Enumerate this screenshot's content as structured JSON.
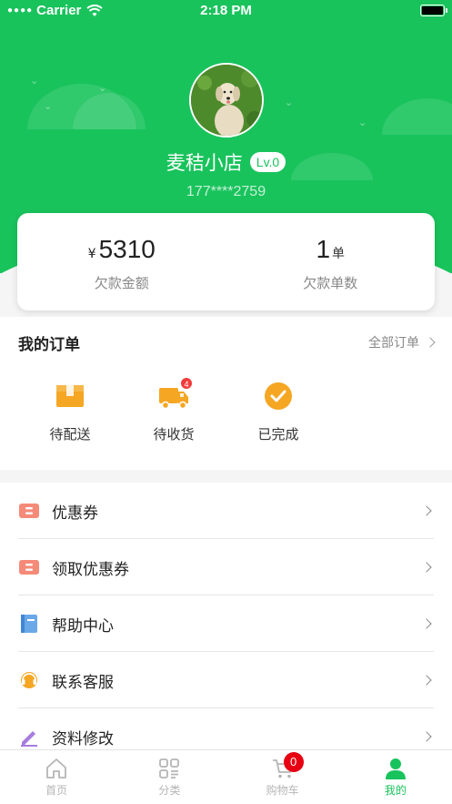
{
  "status_bar": {
    "carrier": "Carrier",
    "time": "2:18 PM"
  },
  "profile": {
    "shop_name": "麦秸小店",
    "level": "Lv.0",
    "phone": "177****2759"
  },
  "stats": {
    "debt_amount": {
      "currency": "¥",
      "value": "5310",
      "label": "欠款金额"
    },
    "debt_orders": {
      "value": "1",
      "unit": "单",
      "label": "欠款单数"
    }
  },
  "orders": {
    "title": "我的订单",
    "all_label": "全部订单",
    "items": [
      {
        "label": "待配送",
        "icon": "box-icon"
      },
      {
        "label": "待收货",
        "icon": "truck-icon",
        "badge": "4"
      },
      {
        "label": "已完成",
        "icon": "check-circle-icon"
      }
    ]
  },
  "menu": {
    "items": [
      {
        "label": "优惠券",
        "icon": "coupon-icon"
      },
      {
        "label": "领取优惠券",
        "icon": "coupon-receive-icon"
      },
      {
        "label": "帮助中心",
        "icon": "book-icon"
      },
      {
        "label": "联系客服",
        "icon": "headset-icon"
      },
      {
        "label": "资料修改",
        "icon": "edit-icon"
      }
    ]
  },
  "tabbar": {
    "items": [
      {
        "label": "首页",
        "icon": "home-icon"
      },
      {
        "label": "分类",
        "icon": "category-icon"
      },
      {
        "label": "购物车",
        "icon": "cart-icon",
        "badge": "0"
      },
      {
        "label": "我的",
        "icon": "user-icon",
        "active": true
      }
    ]
  },
  "colors": {
    "brand": "#19c35c",
    "badge_red": "#f23b3b",
    "icon_orange": "#f5a623"
  }
}
